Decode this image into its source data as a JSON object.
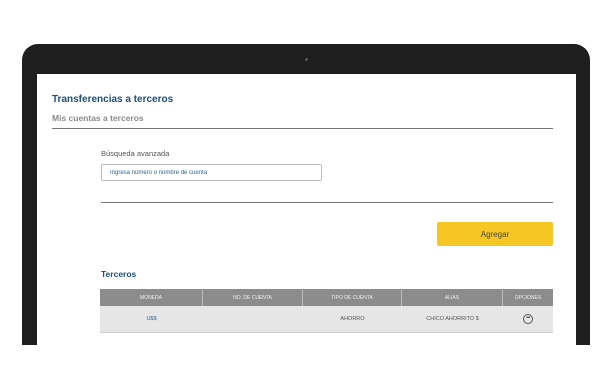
{
  "page": {
    "title": "Transferencias a terceros",
    "subtitle": "Mis cuentas a terceros"
  },
  "search": {
    "label": "Búsqueda avanzada",
    "placeholder": "Ingresa número o nombre de cuenta",
    "value": ""
  },
  "actions": {
    "add_label": "Agregar"
  },
  "section": {
    "title": "Terceros"
  },
  "table": {
    "headers": [
      "MONEDA",
      "NO. DE CUENTA",
      "TIPO DE CUENTA",
      "ALIAS",
      "OPCIONES"
    ],
    "rows": [
      {
        "currency": "U$$",
        "account_number": "",
        "account_type": "AHORRO",
        "alias": "CHICO AHORRITO $",
        "options_icon": "more-options-icon"
      }
    ]
  },
  "colors": {
    "accent_yellow": "#f6c625",
    "title_blue": "#1b4f79",
    "header_gray": "#8c8c8c",
    "row_gray": "#e6e6e6"
  }
}
